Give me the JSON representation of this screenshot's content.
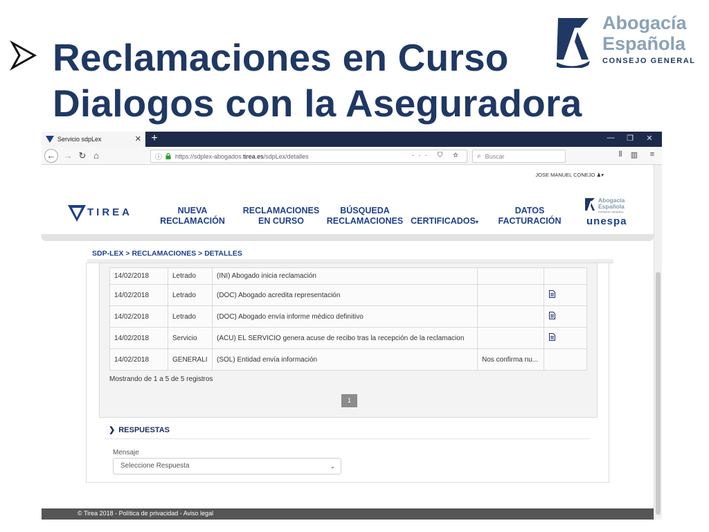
{
  "slide": {
    "title_line1": "Reclamaciones en Curso",
    "title_line2": "Dialogos con la Aseguradora"
  },
  "logo": {
    "name_line1": "Abogacía",
    "name_line2": "Española",
    "subtitle": "CONSEJO GENERAL"
  },
  "browser": {
    "tab_title": "Servicio sdpLex",
    "url_prefix": "https://sdplex-abogados.",
    "url_domain": "tirea.es",
    "url_path": "/sdpLex/detalles",
    "search_placeholder": "Buscar"
  },
  "site": {
    "user_name": "JOSE MANUEL CONEJO",
    "tirea_brand": "TIREA",
    "menu": [
      {
        "line1": "NUEVA",
        "line2": "RECLAMACIÓN"
      },
      {
        "line1": "RECLAMACIONES",
        "line2": "EN CURSO"
      },
      {
        "line1": "BÚSQUEDA",
        "line2": "RECLAMACIONES"
      },
      {
        "line1": "CERTIFICADOS",
        "line2": ""
      },
      {
        "line1": "DATOS",
        "line2": "FACTURACIÓN"
      }
    ],
    "partner_small_line1": "Abogacía",
    "partner_small_line2": "Española",
    "partner_small_sub": "CONSEJO GENERAL",
    "unespa": "unespa"
  },
  "breadcrumb": "SDP-LEX > RECLAMACIONES > DETALLES",
  "history": {
    "rows": [
      {
        "date": "14/02/2018",
        "who": "Letrado",
        "desc": "(INI) Abogado inicia reclamación",
        "obs": "",
        "doc": false
      },
      {
        "date": "14/02/2018",
        "who": "Letrado",
        "desc": "(DOC) Abogado acredita representación",
        "obs": "",
        "doc": true
      },
      {
        "date": "14/02/2018",
        "who": "Letrado",
        "desc": "(DOC) Abogado envía informe médico definitivo",
        "obs": "",
        "doc": true
      },
      {
        "date": "14/02/2018",
        "who": "Servicio",
        "desc": "(ACU) EL SERVICIO genera acuse de recibo tras la recepción de la reclamacion",
        "obs": "",
        "doc": true
      },
      {
        "date": "14/02/2018",
        "who": "GENERALI",
        "desc": "(SOL) Entidad envía información",
        "obs": "Nos confirma nu...",
        "doc": false
      }
    ],
    "showing": "Mostrando de 1 a 5 de 5 registros",
    "page": "1"
  },
  "respuestas": {
    "title": "RESPUESTAS",
    "mensaje_label": "Mensaje",
    "select_value": "Seleccione Respuesta"
  },
  "footer": "© Tirea 2018 - Política de privacidad - Aviso legal",
  "colors": {
    "title": "#1f3864",
    "brand_blue": "#1d3f8c",
    "logo_grey": "#8aa2b7",
    "tabbar": "#1e2a4a"
  }
}
